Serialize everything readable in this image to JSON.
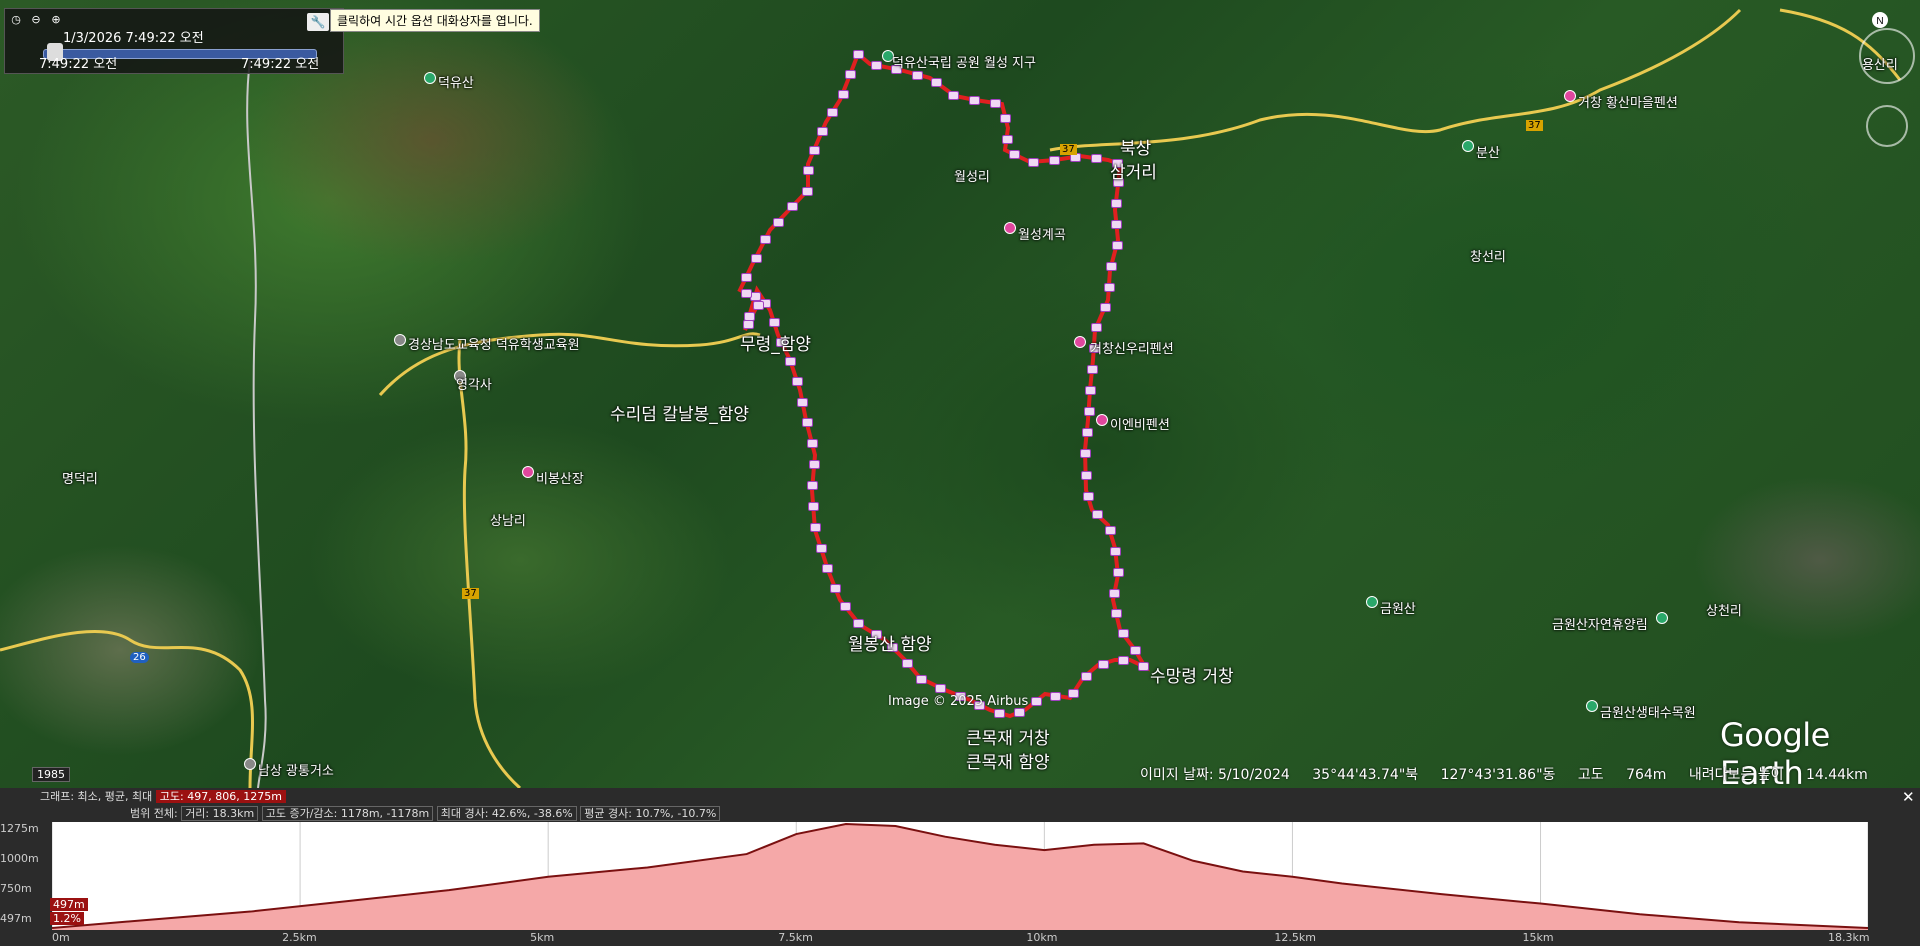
{
  "timebar": {
    "date_time": "1/3/2026    7:49:22 오전",
    "start_time": "7:49:22 오전",
    "end_time": "7:49:22 오전"
  },
  "tooltip": "클릭하여 시간 옵션 대화상자를 엽니다.",
  "labels": {
    "deogyusan": "덕유산",
    "gyeongsangnamdo_edu": "경상남도교육청 덕유학생교육원",
    "yeonggaksa": "영각사",
    "myeongdeokri": "명덕리",
    "bongsanjang": "비봉산장",
    "sangri": "상남리",
    "suri": "수리덤 칼날봉_함양",
    "hamyang_top": "무령_함양",
    "wolbong": "월봉산 함양",
    "keunmokjae_1": "큰목재 거창",
    "keunmokjae_2": "큰목재 함양",
    "sumangryeong": "수망령 거창",
    "wolseongri": "월성리",
    "wolseong_valley": "월성계곡",
    "bukchang": "북상",
    "samgeori": "삼거리",
    "pension1": "거창신우리펜션",
    "pension2": "이엔비펜션",
    "sangsanri": "창선리",
    "bunsan": "분산",
    "geumwonsan": "금원산",
    "geumwon_forest": "금원산자연휴양림",
    "geumwon_eco": "금원산생태수목원",
    "sangcheonri": "상천리",
    "gongwon": "덕유산국립 공원 월성 지구",
    "pension3": "거창 황산마을펜션",
    "yongsanri": "용산리",
    "road37a": "37",
    "road37b": "37",
    "road37c": "37",
    "road26": "26",
    "gwangtong": "남상 광통거소"
  },
  "status": {
    "image_date": "이미지 날짜: 5/10/2024",
    "lat": "35°44'43.74\"북",
    "lon": "127°43'31.86\"동",
    "elev_label": "고도",
    "elev": "764m",
    "eye_label": "내려다보는 높이",
    "eye": "14.44km"
  },
  "credit": "Image © 2025 Airbus",
  "watermark": "Google Earth",
  "year": "1985",
  "profile": {
    "row1_label": "그래프: 최소, 평균, 최대",
    "row1_value": "고도: 497, 806, 1275m",
    "row2_label": "범위 전체:",
    "row2_dist": "거리: 18.3km",
    "row2_gain": "고도 증가/감소: 1178m, -1178m",
    "row2_max": "최대 경사: 42.6%, -38.6%",
    "row2_avg": "평균 경사: 10.7%, -10.7%",
    "y_labels": [
      "1275m",
      "1000m",
      "750m",
      "497m"
    ],
    "x_labels": [
      "0m",
      "2.5km",
      "5km",
      "7.5km",
      "10km",
      "12.5km",
      "15km",
      "18.3km"
    ],
    "cursor_elev": "497m",
    "cursor_slope": "1.2%"
  },
  "chart_data": {
    "type": "area",
    "title": "",
    "xlabel": "",
    "ylabel": "",
    "x": [
      0,
      1,
      2,
      3,
      4,
      5,
      6,
      7,
      7.5,
      8,
      8.5,
      9,
      9.5,
      10,
      10.5,
      11,
      11.5,
      12,
      12.5,
      13,
      14,
      15,
      16,
      17,
      18.3
    ],
    "y": [
      497,
      560,
      620,
      700,
      780,
      880,
      950,
      1050,
      1200,
      1275,
      1260,
      1180,
      1120,
      1080,
      1120,
      1130,
      1000,
      920,
      880,
      830,
      750,
      680,
      600,
      540,
      497
    ],
    "xlim": [
      0,
      18.3
    ],
    "ylim": [
      497,
      1275
    ],
    "colors": {
      "line": "#7a1010",
      "fill": "#f5a8a8"
    }
  },
  "colors": {
    "route": "#e02020",
    "waypoint": "#a040c0"
  }
}
